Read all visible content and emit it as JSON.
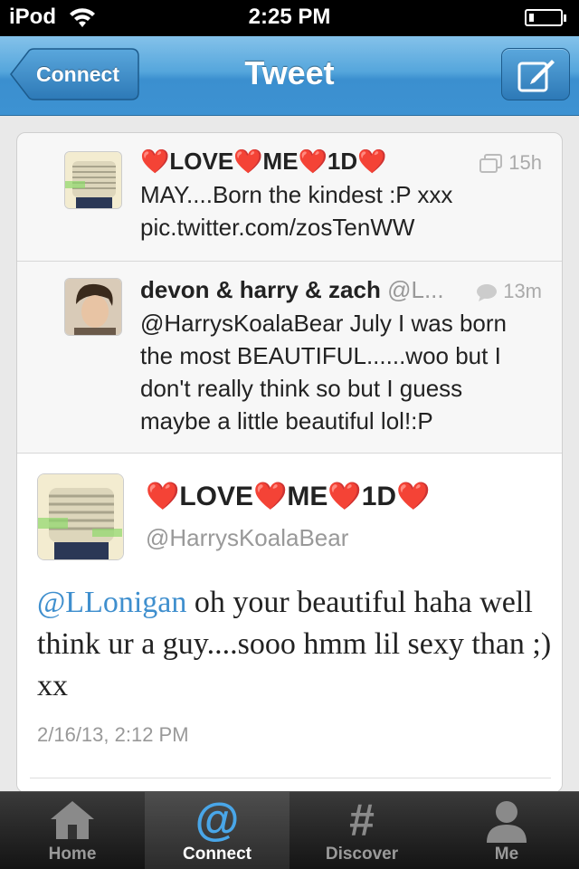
{
  "status_bar": {
    "carrier": "iPod",
    "time": "2:25 PM"
  },
  "nav": {
    "back_label": "Connect",
    "title": "Tweet",
    "compose_icon": "compose-icon"
  },
  "timeline": [
    {
      "name": "❤️LOVE❤️ME❤️1D❤️",
      "handle": "",
      "time": "15h",
      "meta_icon": "conversation-icon",
      "text": "MAY....Born the kindest :P xxx pic.twitter.com/zosTenWW"
    },
    {
      "name": "devon & harry & zach",
      "handle": "@L...",
      "time": "13m",
      "meta_icon": "reply-bubble-icon",
      "text": "@HarrysKoalaBear July I was born the most BEAUTIFUL......woo but I don't really think so but I guess maybe a little beautiful lol!:P"
    }
  ],
  "focused_tweet": {
    "name": "❤️LOVE❤️ME❤️1D❤️",
    "handle": "@HarrysKoalaBear",
    "mention": "@LLonigan",
    "text": " oh your beautiful haha well think ur a guy....sooo hmm lil sexy than ;) xx",
    "timestamp": "2/16/13, 2:12 PM"
  },
  "tabs": [
    {
      "label": "Home",
      "icon": "home-icon",
      "active": false
    },
    {
      "label": "Connect",
      "icon": "at-icon",
      "active": true
    },
    {
      "label": "Discover",
      "icon": "hashtag-icon",
      "active": false
    },
    {
      "label": "Me",
      "icon": "person-icon",
      "active": false
    }
  ],
  "colors": {
    "nav_blue": "#3b8fcf",
    "mention_blue": "#3f8fce",
    "heart_red": "#d62a2a"
  }
}
